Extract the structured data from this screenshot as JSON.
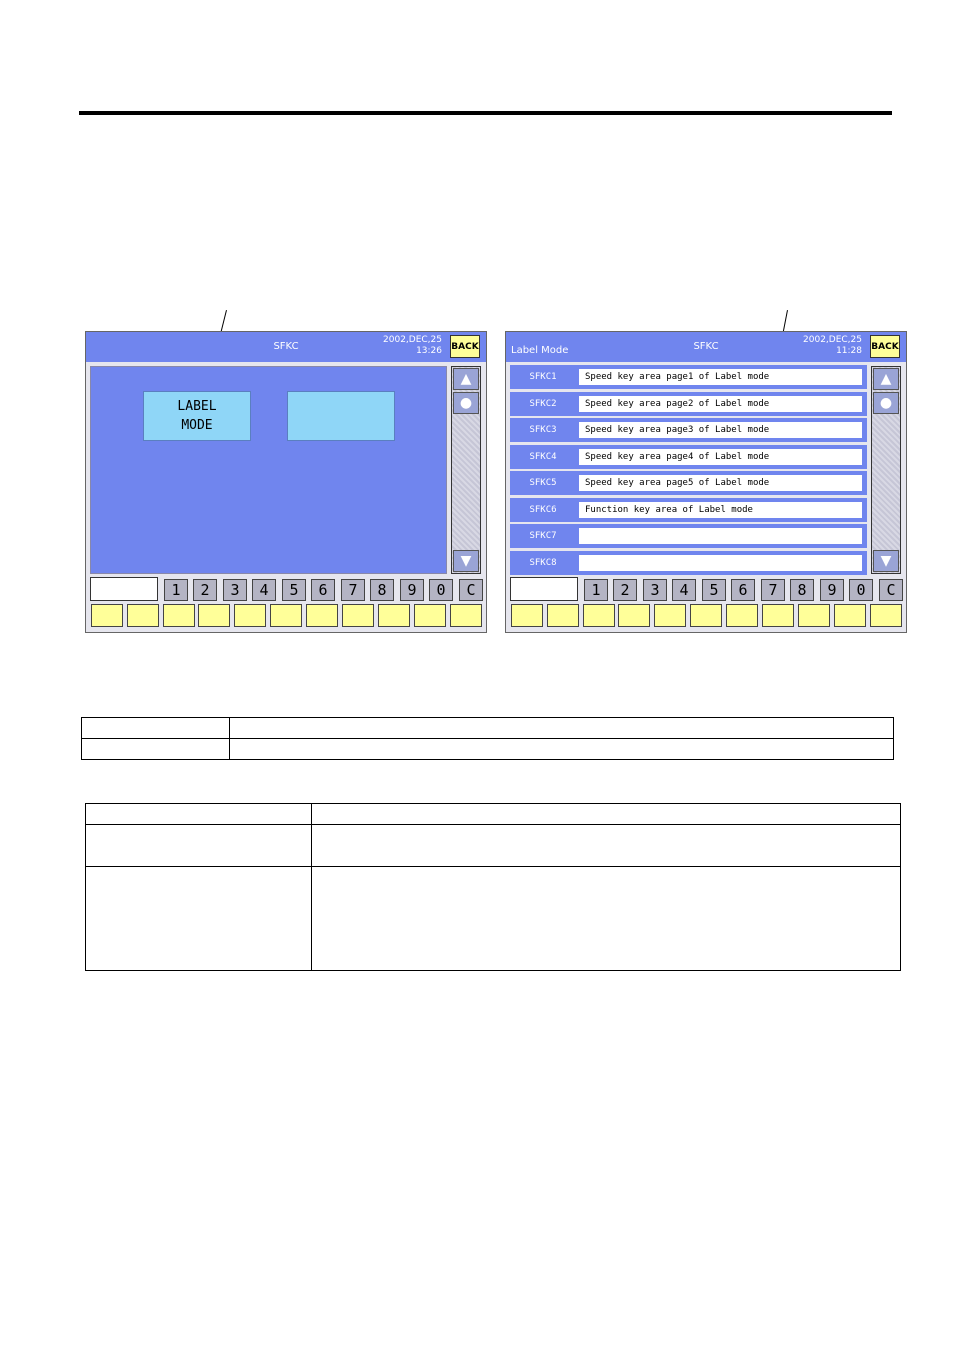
{
  "screen1": {
    "title": "SFKC",
    "date": "2002,DEC,25",
    "time": "13:26",
    "back_label": "BACK",
    "buttons": [
      "LABEL\nMODE",
      ""
    ],
    "keypad": [
      "1",
      "2",
      "3",
      "4",
      "5",
      "6",
      "7",
      "8",
      "9",
      "0",
      "C"
    ],
    "scroll_icons": [
      "up-arrow-icon",
      "circle-icon",
      "down-arrow-icon"
    ]
  },
  "screen2": {
    "mode": "Label Mode",
    "title": "SFKC",
    "date": "2002,DEC,25",
    "time": "11:28",
    "back_label": "BACK",
    "rows": [
      {
        "code": "SFKC1",
        "text": "Speed key area page1 of Label mode"
      },
      {
        "code": "SFKC2",
        "text": "Speed key area page2 of Label mode"
      },
      {
        "code": "SFKC3",
        "text": "Speed key area page3 of Label mode"
      },
      {
        "code": "SFKC4",
        "text": "Speed key area page4 of Label mode"
      },
      {
        "code": "SFKC5",
        "text": "Speed key area page5 of Label mode"
      },
      {
        "code": "SFKC6",
        "text": "Function key area of Label mode"
      },
      {
        "code": "SFKC7",
        "text": ""
      },
      {
        "code": "SFKC8",
        "text": ""
      }
    ],
    "keypad": [
      "1",
      "2",
      "3",
      "4",
      "5",
      "6",
      "7",
      "8",
      "9",
      "0",
      "C"
    ]
  },
  "colors": {
    "titlebar": "#7085ee",
    "mode_button": "#8fd6f7",
    "back": "#ffff99",
    "key": "#b4b4c4",
    "fkey": "#ffff99"
  }
}
